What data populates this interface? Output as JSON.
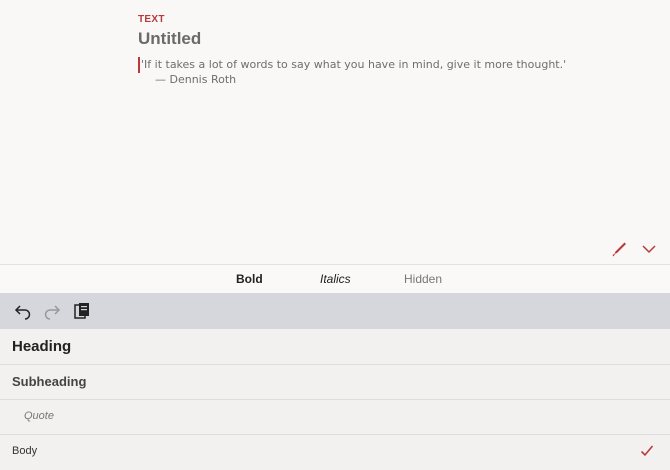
{
  "editor": {
    "type_label": "TEXT",
    "title": "Untitled",
    "quote_line": "'If it takes a lot of words to say what you have in mind, give it more thought.'",
    "attribution": "— Dennis Roth",
    "icons": {
      "pen": "pen-icon",
      "collapse": "chevron-down-icon"
    }
  },
  "format_bar": {
    "bold": "Bold",
    "italics": "Italics",
    "hidden": "Hidden"
  },
  "toolbar": {
    "icons": [
      "undo-icon",
      "redo-icon",
      "paste-icon"
    ]
  },
  "styles": [
    {
      "label": "Heading"
    },
    {
      "label": "Subheading"
    },
    {
      "label": "Quote"
    },
    {
      "label": "Body",
      "selected": true
    }
  ],
  "colors": {
    "accent": "#b83a3a",
    "toolbar_bg": "#d5d7dd"
  }
}
